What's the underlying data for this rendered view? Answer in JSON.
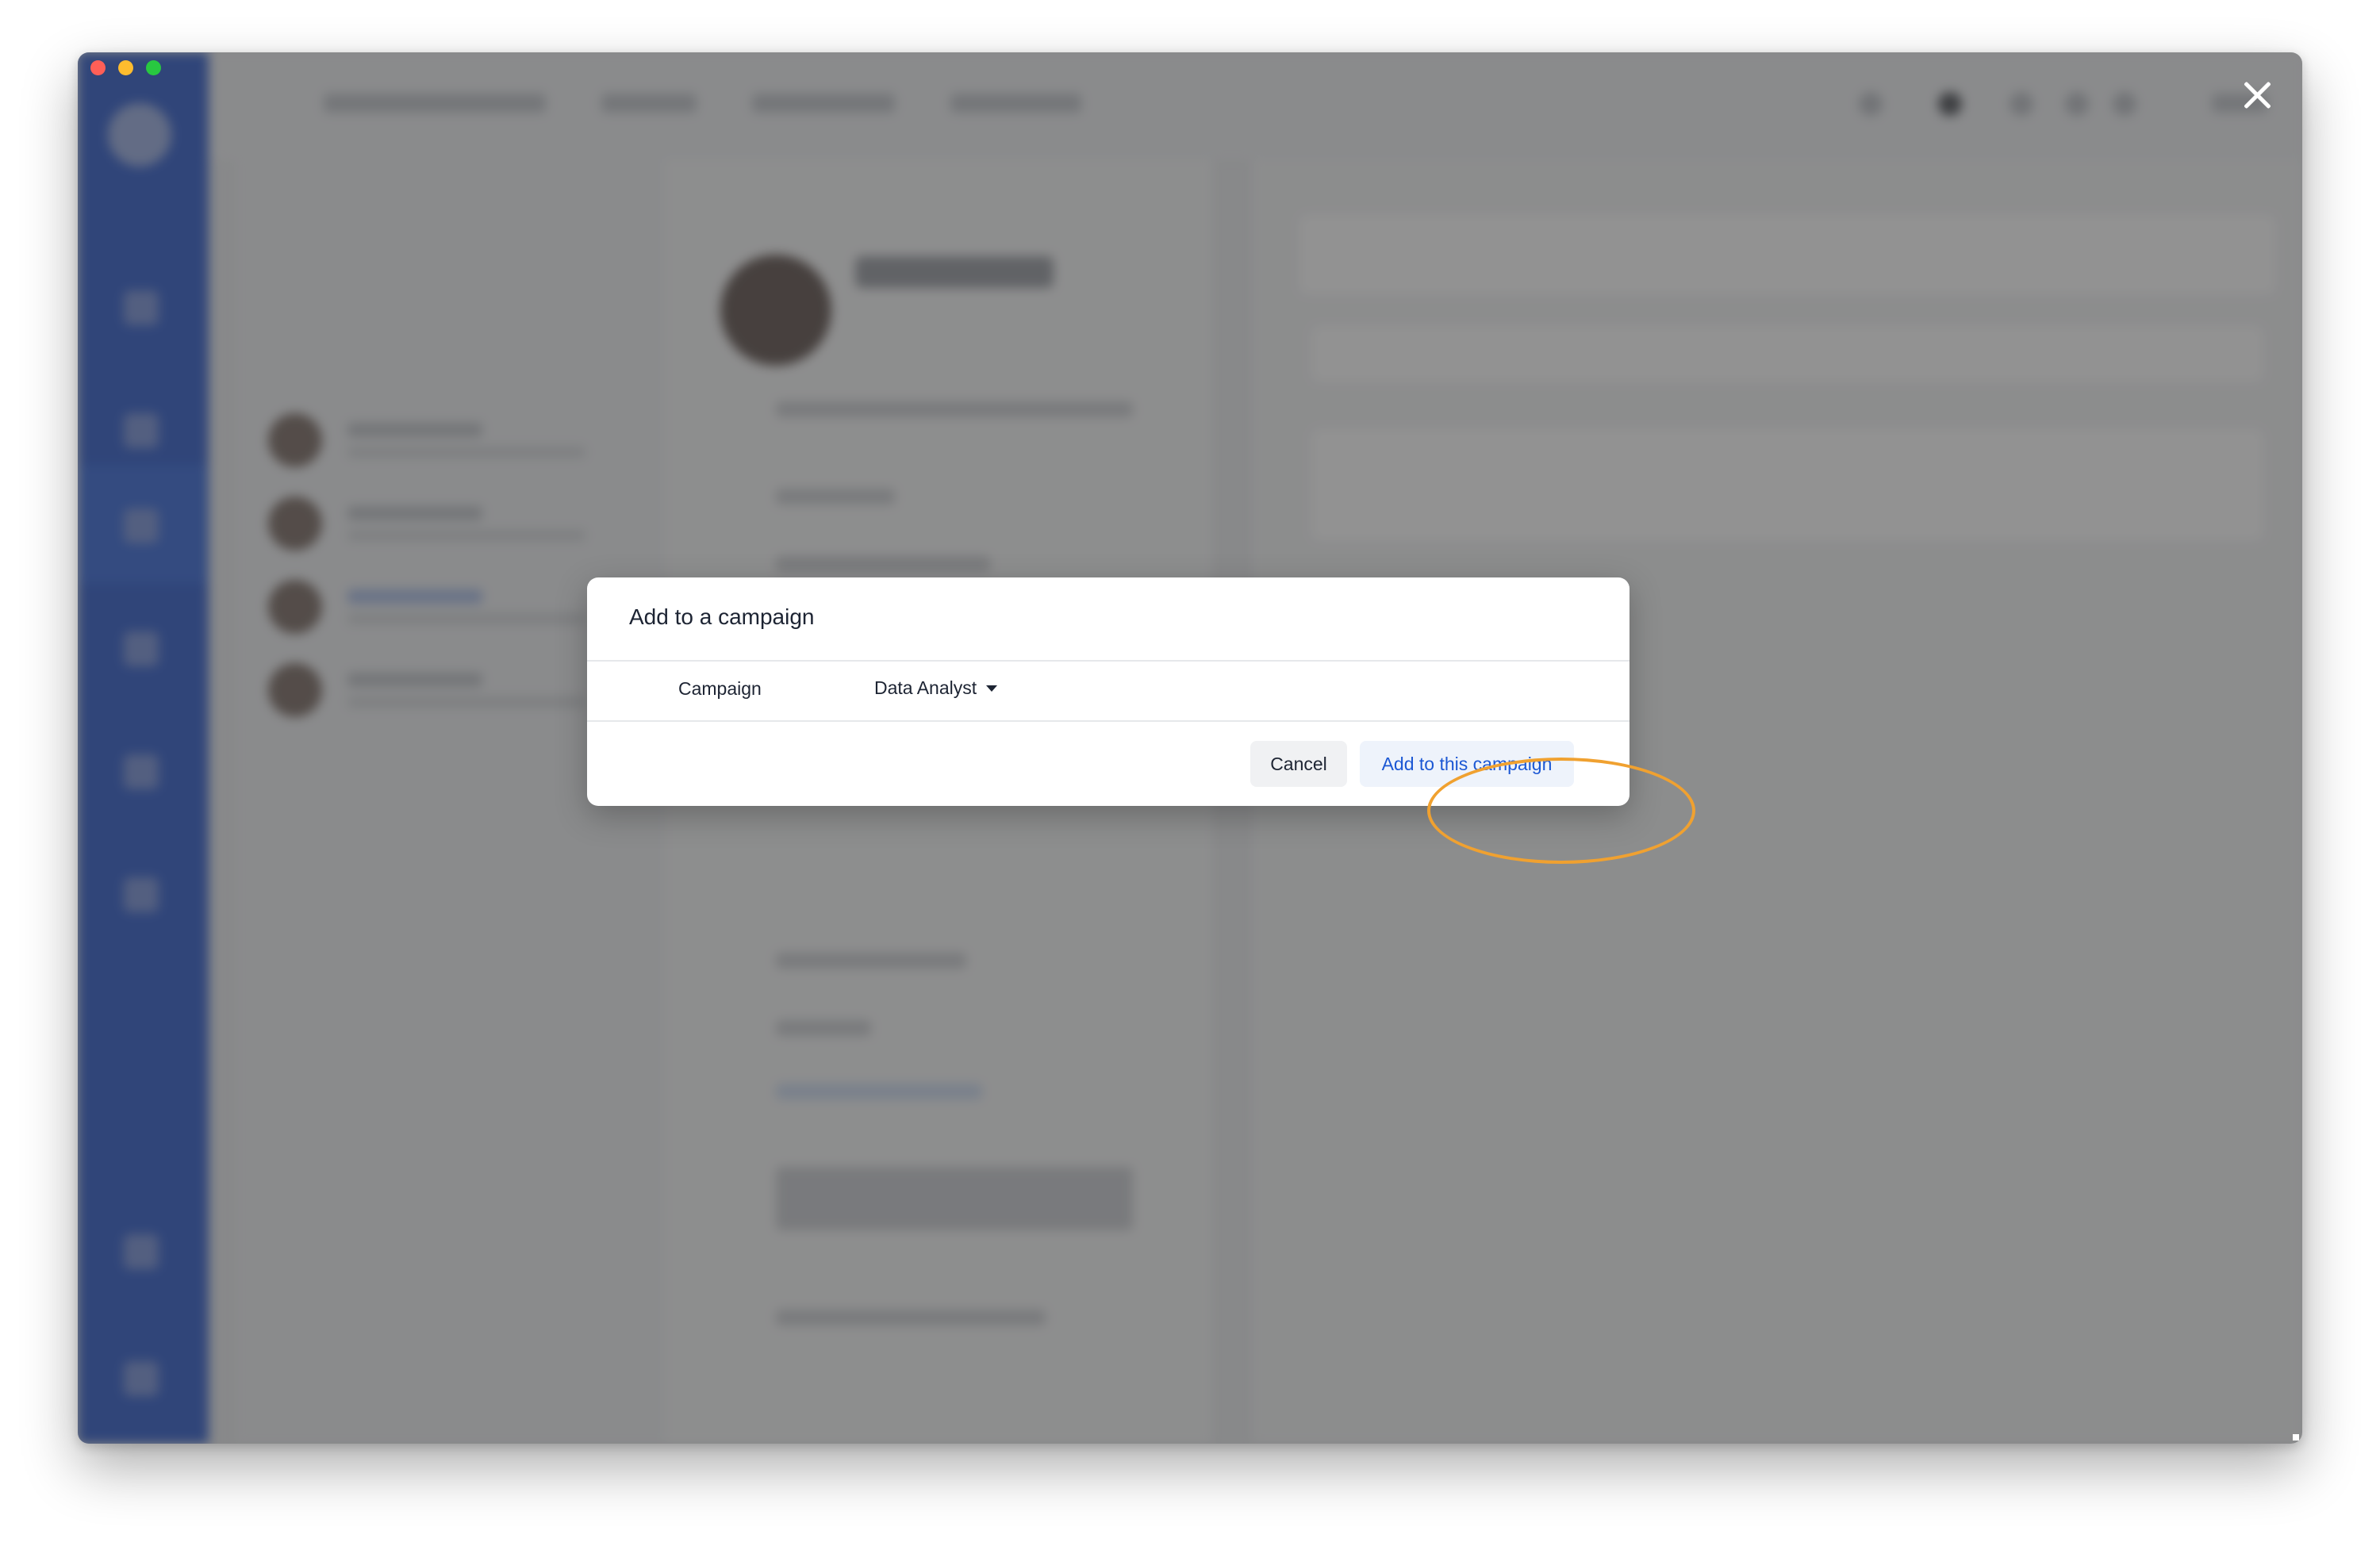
{
  "modal": {
    "title": "Add to a campaign",
    "field_label": "Campaign",
    "selected_campaign": "Data Analyst",
    "cancel_label": "Cancel",
    "confirm_label": "Add to this campaign"
  },
  "colors": {
    "sidebar": "#1648c4",
    "accent": "#1c58d4",
    "highlight_ring": "#f0a130",
    "overlay": "#444444"
  },
  "icons": {
    "window_close": "close-icon",
    "select_caret": "caret-down-icon"
  }
}
